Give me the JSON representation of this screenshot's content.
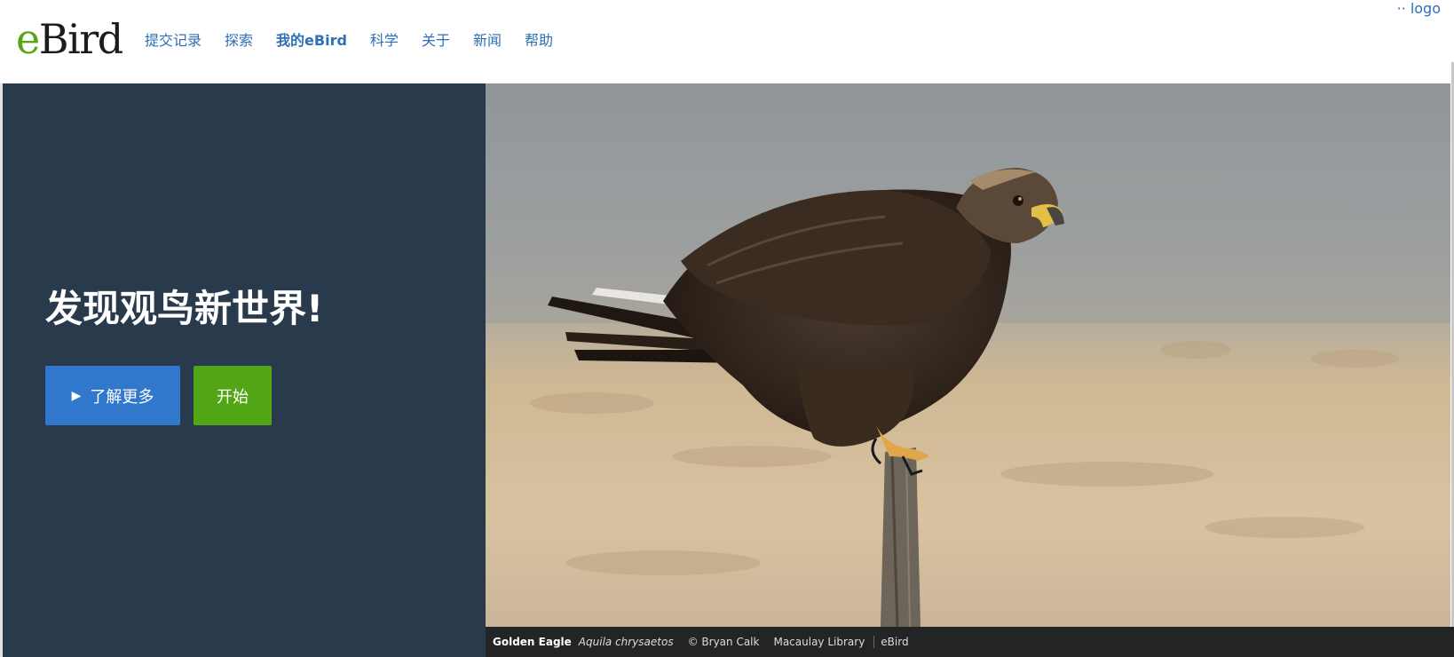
{
  "header": {
    "logo_e": "e",
    "logo_rest": "Bird",
    "nav": [
      {
        "label": "提交记录"
      },
      {
        "label": "探索"
      },
      {
        "label": "我的eBird"
      },
      {
        "label": "科学"
      },
      {
        "label": "关于"
      },
      {
        "label": "新闻"
      },
      {
        "label": "帮助"
      }
    ],
    "corner_text": "·· logo"
  },
  "hero": {
    "headline": "发现观鸟新世界!",
    "learn_more_label": "了解更多",
    "start_label": "开始",
    "colors": {
      "panel_bg": "#293a4c",
      "learn_more_bg": "#3178cc",
      "start_bg": "#52a615",
      "brand_green": "#55a515",
      "nav_link": "#2f6fb5"
    }
  },
  "photo": {
    "subject": "golden-eagle-on-post",
    "common_name": "Golden Eagle",
    "scientific_name": "Aquila chrysaetos",
    "credit": "© Bryan Calk",
    "library": "Macaulay Library",
    "source": "eBird"
  }
}
